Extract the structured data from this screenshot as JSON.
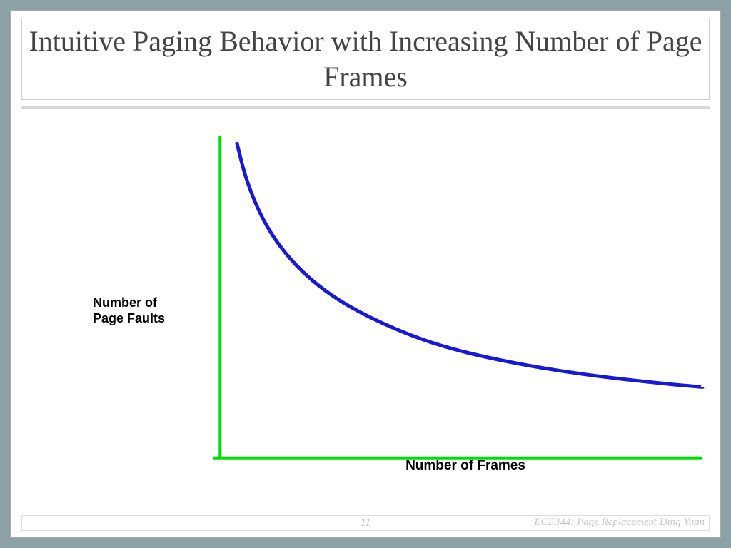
{
  "slide": {
    "title": "Intuitive Paging Behavior with Increasing Number of Page Frames",
    "page_number": "11",
    "course_info": "ECE344: Page Replacement Ding Yuan"
  },
  "chart_data": {
    "type": "line",
    "title": "",
    "xlabel": "Number of Frames",
    "ylabel": "Number of\nPage Faults",
    "xlim": [
      0,
      100
    ],
    "ylim": [
      0,
      100
    ],
    "series": [
      {
        "name": "page-faults",
        "x": [
          2,
          4,
          8,
          14,
          22,
          32,
          44,
          58,
          74,
          92,
          100
        ],
        "values": [
          98,
          86,
          72,
          60,
          50,
          42,
          35,
          30,
          26,
          23,
          22
        ]
      }
    ],
    "colors": {
      "axis": "#00e000",
      "curve": "#1818d8"
    }
  }
}
